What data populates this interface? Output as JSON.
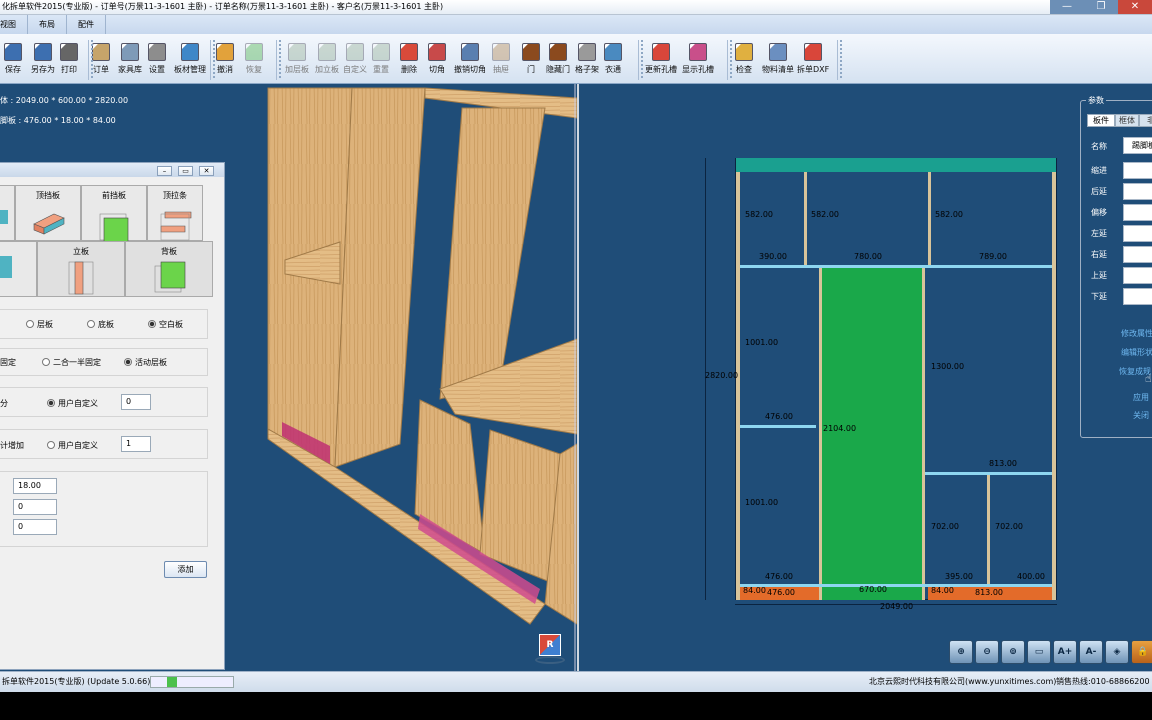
{
  "window": {
    "title": "化拆单软件2015(专业版) - 订单号(万景11-3-1601 主卧) - 订单名称(万景11-3-1601 主卧) - 客户名(万景11-3-1601 主卧)",
    "controls": [
      "—",
      "❐",
      "✕"
    ]
  },
  "menu": {
    "tabs": [
      "视图",
      "布局",
      "配件"
    ]
  },
  "toolbar": {
    "buttons": [
      {
        "label": "保存",
        "icon": "save-icon",
        "color": "#3d6fb0",
        "enabled": true
      },
      {
        "label": "另存为",
        "icon": "save-as-icon",
        "color": "#3d6fb0",
        "enabled": true
      },
      {
        "label": "打印",
        "icon": "printer-icon",
        "color": "#666666",
        "enabled": true
      },
      {
        "label": "订单",
        "icon": "order-icon",
        "color": "#c6a46a",
        "enabled": true
      },
      {
        "label": "家具库",
        "icon": "furniture-library-icon",
        "color": "#7e9ab8",
        "enabled": true
      },
      {
        "label": "设置",
        "icon": "settings-gear-icon",
        "color": "#8d8d8d",
        "enabled": true
      },
      {
        "label": "板材管理",
        "icon": "board-manage-icon",
        "color": "#3f87c8",
        "enabled": true
      },
      {
        "label": "撤消",
        "icon": "undo-icon",
        "color": "#e2a23b",
        "enabled": true
      },
      {
        "label": "恢复",
        "icon": "redo-icon",
        "color": "#5dbb5d",
        "enabled": false
      },
      {
        "label": "加层板",
        "icon": "add-shelf-icon",
        "color": "#9fb7a0",
        "enabled": false
      },
      {
        "label": "加立板",
        "icon": "add-vertical-board-icon",
        "color": "#9fb7a0",
        "enabled": false
      },
      {
        "label": "自定义",
        "icon": "custom-icon",
        "color": "#9fb7a0",
        "enabled": false
      },
      {
        "label": "重置",
        "icon": "reset-icon",
        "color": "#9fb7a0",
        "enabled": false
      },
      {
        "label": "删除",
        "icon": "delete-icon",
        "color": "#d94a3a",
        "enabled": true
      },
      {
        "label": "切角",
        "icon": "cut-corner-icon",
        "color": "#c84a4a",
        "enabled": true
      },
      {
        "label": "撤销切角",
        "icon": "undo-cut-corner-icon",
        "color": "#5a7fb0",
        "enabled": true
      },
      {
        "label": "抽屉",
        "icon": "drawer-icon",
        "color": "#b89060",
        "enabled": false
      },
      {
        "label": "门",
        "icon": "door-icon",
        "color": "#8b4a1e",
        "enabled": true
      },
      {
        "label": "隐藏门",
        "icon": "hide-door-icon",
        "color": "#8b4a1e",
        "enabled": true
      },
      {
        "label": "格子架",
        "icon": "grid-rack-icon",
        "color": "#9a9a9a",
        "enabled": true
      },
      {
        "label": "衣通",
        "icon": "hanger-rail-icon",
        "color": "#4a8ac0",
        "enabled": true
      },
      {
        "label": "更新孔槽",
        "icon": "update-holes-icon",
        "color": "#d9463a",
        "enabled": true
      },
      {
        "label": "显示孔槽",
        "icon": "show-holes-icon",
        "color": "#c94f8a",
        "enabled": true
      },
      {
        "label": "检查",
        "icon": "check-icon",
        "color": "#e0b040",
        "enabled": true
      },
      {
        "label": "物料清单",
        "icon": "material-list-icon",
        "color": "#6b8fc0",
        "enabled": true
      },
      {
        "label": "拆单DXF",
        "icon": "export-dxf-icon",
        "color": "#d9463a",
        "enabled": true
      }
    ]
  },
  "view3d": {
    "info_line1": "体 : 2049.00 * 600.00 * 2820.00",
    "info_line2": "脚板 : 476.00 * 18.00 * 84.00",
    "cube_label": "R"
  },
  "dialog": {
    "panes_top": [
      {
        "label": "顶挡板"
      },
      {
        "label": "前挡板"
      },
      {
        "label": "顶拉条"
      }
    ],
    "panes_mid": [
      {
        "label": "立板"
      },
      {
        "label": "背板"
      }
    ],
    "board_types": [
      {
        "label": "层板",
        "on": false
      },
      {
        "label": "底板",
        "on": false
      },
      {
        "label": "空白板",
        "on": true
      }
    ],
    "fix_types": [
      {
        "label": "固定",
        "on": false
      },
      {
        "label": "二合一半固定",
        "on": false
      },
      {
        "label": "活动层板",
        "on": true
      }
    ],
    "split_label": "分",
    "split_custom": "用户自定义",
    "split_value": "0",
    "count_label": "计增加",
    "count_custom": "用户自定义",
    "count_value": "1",
    "thickness": "18.00",
    "field2": "0",
    "field3": "0",
    "add_button": "添加"
  },
  "view2d": {
    "dims": {
      "top_left": "582.00",
      "top_mid": "582.00",
      "top_right": "582.00",
      "w_left": "390.00",
      "w_mid": "780.00",
      "w_right": "789.00",
      "h_left_upper": "1001.00",
      "w_left_shelf": "476.00",
      "h_left_lower": "1001.00",
      "h_center": "2104.00",
      "h_right_upper": "1300.00",
      "w_right_shelf": "813.00",
      "h_right_low_left": "702.00",
      "h_right_low_right": "702.00",
      "w_bottom_left": "476.00",
      "w_bottom_center": "670.00",
      "w_bottom_rl": "395.00",
      "w_bottom_rr": "400.00",
      "plinth_h_left": "84.00",
      "plinth_w_left": "476.00",
      "plinth_h_right": "84.00",
      "plinth_w_right": "813.00",
      "total_height": "2820.00",
      "total_width": "2049.00"
    },
    "colors": {
      "top_bar": "#1aa090",
      "center_door": "#1aa84a",
      "plinth": "#e36b2a",
      "frame": "#d8c49a",
      "shelf": "#8ed6f0"
    }
  },
  "params": {
    "title": "参数",
    "tabs": [
      "板件",
      "框体",
      "非"
    ],
    "name_label": "名称",
    "name_value": "踢脚板",
    "fields": [
      "缩进",
      "后延",
      "偏移",
      "左延",
      "右延",
      "上延",
      "下延"
    ],
    "links": [
      "修改属性",
      "编辑形状",
      "恢复成规",
      "应用",
      "关闭"
    ]
  },
  "zoom_tools": [
    "⊕",
    "⊖",
    "⊚",
    "▭",
    "A+",
    "A-",
    "◈",
    "🔒"
  ],
  "status": {
    "app": "拆单软件2015(专业版) (Update 5.0.66)",
    "company": "北京云熙时代科技有限公司(www.yunxitimes.com)",
    "hotline": "销售热线:010-68866200"
  }
}
